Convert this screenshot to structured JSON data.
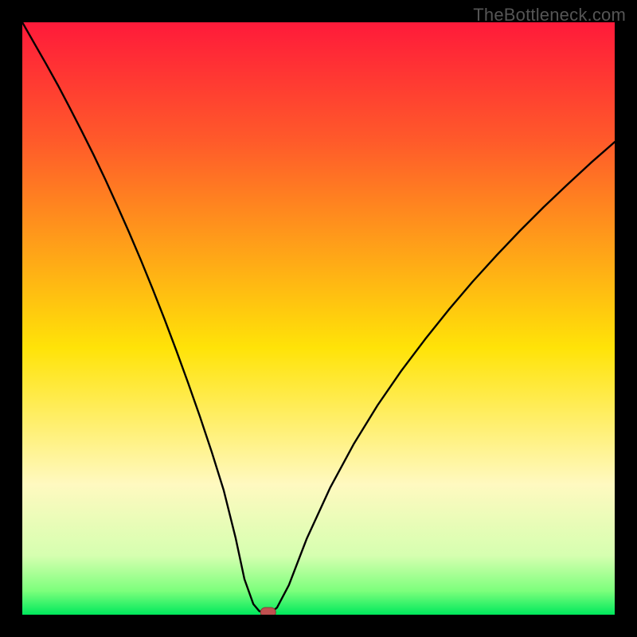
{
  "watermark": "TheBottleneck.com",
  "colors": {
    "black": "#000000",
    "gradient_top": "#ff1a3a",
    "gradient_upper": "#ff5a2a",
    "gradient_mid": "#ffe308",
    "gradient_lower": "#fff9c0",
    "gradient_low2": "#d6ffb0",
    "gradient_bottom_upper": "#7cff7c",
    "gradient_bottom": "#00e85c",
    "curve": "#000000",
    "marker_fill": "#c05050",
    "marker_stroke": "#8a3838"
  },
  "chart_data": {
    "type": "line",
    "title": "",
    "xlabel": "",
    "ylabel": "",
    "xlim": [
      0,
      100
    ],
    "ylim": [
      0,
      100
    ],
    "x": [
      0,
      2,
      4,
      6,
      8,
      10,
      12,
      14,
      16,
      18,
      20,
      22,
      24,
      26,
      28,
      30,
      32,
      34,
      36,
      37.5,
      39,
      40,
      41,
      42,
      43,
      45,
      48,
      52,
      56,
      60,
      64,
      68,
      72,
      76,
      80,
      84,
      88,
      92,
      96,
      100
    ],
    "values": [
      100,
      96.5,
      93,
      89.4,
      85.6,
      81.7,
      77.7,
      73.5,
      69.1,
      64.6,
      59.9,
      55.0,
      49.9,
      44.6,
      39.1,
      33.4,
      27.4,
      21.0,
      13.0,
      6.0,
      1.8,
      0.6,
      0.4,
      0.4,
      1.2,
      5.0,
      12.8,
      21.5,
      28.9,
      35.4,
      41.2,
      46.5,
      51.5,
      56.2,
      60.6,
      64.8,
      68.8,
      72.6,
      76.3,
      79.8
    ],
    "marker": {
      "x": 41.5,
      "y": 0.4
    },
    "gradient_stops": [
      {
        "offset": 0.0,
        "color": "#ff1a3a"
      },
      {
        "offset": 0.2,
        "color": "#ff5a2a"
      },
      {
        "offset": 0.55,
        "color": "#ffe308"
      },
      {
        "offset": 0.78,
        "color": "#fff9c0"
      },
      {
        "offset": 0.9,
        "color": "#d6ffb0"
      },
      {
        "offset": 0.96,
        "color": "#7cff7c"
      },
      {
        "offset": 1.0,
        "color": "#00e85c"
      }
    ]
  }
}
